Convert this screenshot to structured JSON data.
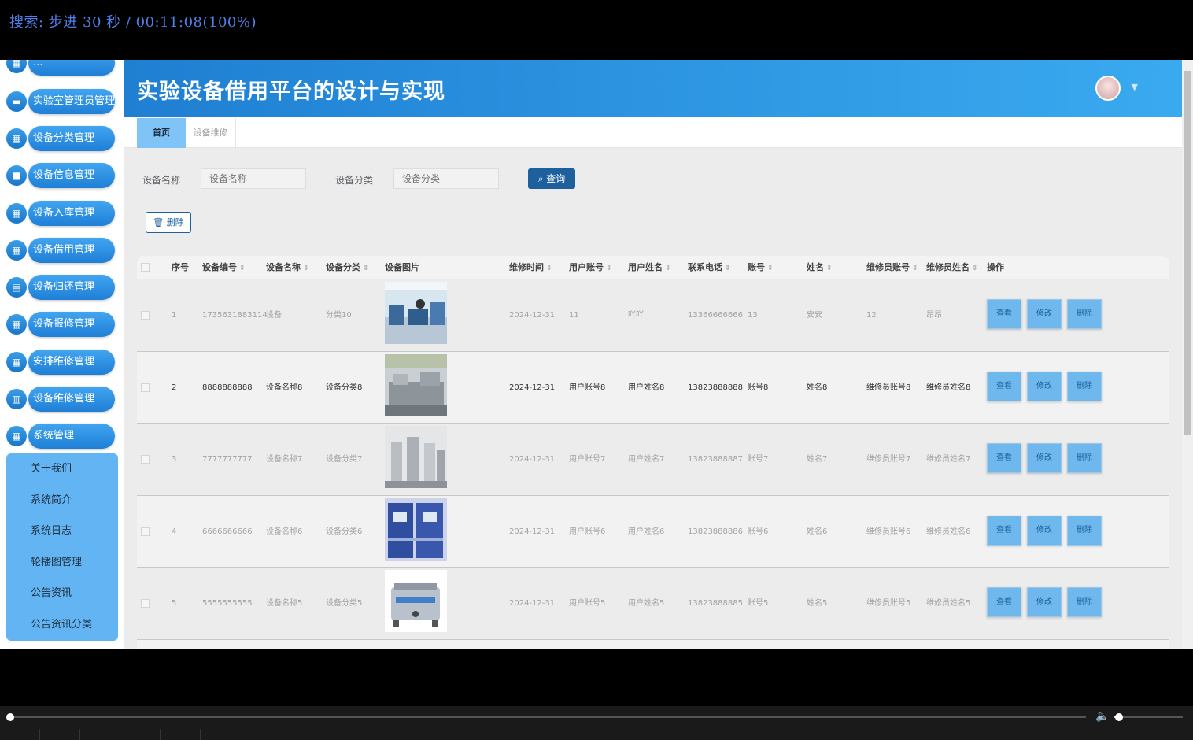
{
  "overlay": {
    "text": "搜索: 步进 30 秒 / 00:11:08(100%)"
  },
  "sidebar": {
    "items": [
      {
        "label": "...",
        "icon": "grid-icon"
      },
      {
        "label": "实验室管理员管理",
        "icon": "monitor-icon"
      },
      {
        "label": "设备分类管理",
        "icon": "grid-icon"
      },
      {
        "label": "设备信息管理",
        "icon": "chat-icon"
      },
      {
        "label": "设备入库管理",
        "icon": "grid-icon"
      },
      {
        "label": "设备借用管理",
        "icon": "grid-icon"
      },
      {
        "label": "设备归还管理",
        "icon": "clipboard-icon"
      },
      {
        "label": "设备报修管理",
        "icon": "grid-icon"
      },
      {
        "label": "安排维修管理",
        "icon": "grid-icon"
      },
      {
        "label": "设备维修管理",
        "icon": "chart-icon"
      },
      {
        "label": "系统管理",
        "icon": "grid-icon"
      }
    ],
    "submenu": [
      "关于我们",
      "系统简介",
      "系统日志",
      "轮播图管理",
      "公告资讯",
      "公告资讯分类"
    ]
  },
  "header": {
    "title": "实验设备借用平台的设计与实现"
  },
  "tabs": {
    "home": "首页",
    "repair": "设备维修"
  },
  "search": {
    "name_label": "设备名称",
    "name_placeholder": "设备名称",
    "category_label": "设备分类",
    "category_placeholder": "设备分类",
    "query_label": "查询"
  },
  "toolbar": {
    "delete_label": "删除"
  },
  "table": {
    "headers": [
      "序号",
      "设备编号",
      "设备名称",
      "设备分类",
      "设备图片",
      "维修时间",
      "用户账号",
      "用户姓名",
      "联系电话",
      "账号",
      "姓名",
      "维修员账号",
      "维修员姓名",
      "操作"
    ],
    "rows": [
      {
        "idx": "1",
        "code": "1735631883114",
        "name": "设备",
        "cat": "分类10",
        "time": "2024-12-31",
        "uacc": "11",
        "uname": "吖吖",
        "phone": "13366666666",
        "acc": "13",
        "pname": "安安",
        "racc": "12",
        "rname": "昂昂"
      },
      {
        "idx": "2",
        "code": "8888888888",
        "name": "设备名称8",
        "cat": "设备分类8",
        "time": "2024-12-31",
        "uacc": "用户账号8",
        "uname": "用户姓名8",
        "phone": "13823888888",
        "acc": "账号8",
        "pname": "姓名8",
        "racc": "维修员账号8",
        "rname": "维修员姓名8"
      },
      {
        "idx": "3",
        "code": "7777777777",
        "name": "设备名称7",
        "cat": "设备分类7",
        "time": "2024-12-31",
        "uacc": "用户账号7",
        "uname": "用户姓名7",
        "phone": "13823888887",
        "acc": "账号7",
        "pname": "姓名7",
        "racc": "维修员账号7",
        "rname": "维修员姓名7"
      },
      {
        "idx": "4",
        "code": "6666666666",
        "name": "设备名称6",
        "cat": "设备分类6",
        "time": "2024-12-31",
        "uacc": "用户账号6",
        "uname": "用户姓名6",
        "phone": "13823888886",
        "acc": "账号6",
        "pname": "姓名6",
        "racc": "维修员账号6",
        "rname": "维修员姓名6"
      },
      {
        "idx": "5",
        "code": "5555555555",
        "name": "设备名称5",
        "cat": "设备分类5",
        "time": "2024-12-31",
        "uacc": "用户账号5",
        "uname": "用户姓名5",
        "phone": "13823888885",
        "acc": "账号5",
        "pname": "姓名5",
        "racc": "维修员账号5",
        "rname": "维修员姓名5"
      }
    ],
    "actions": {
      "view": "查看",
      "edit": "修改",
      "delete": "删除"
    }
  },
  "colors": {
    "accent": "#1e5f9e",
    "header_start": "#1f7fd2",
    "header_end": "#3aaaf0",
    "menu": "#2b8de0"
  }
}
